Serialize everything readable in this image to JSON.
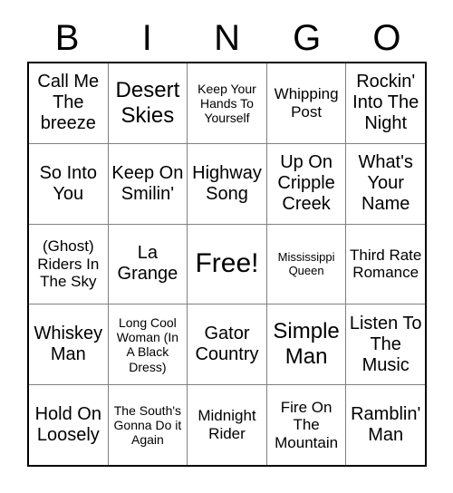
{
  "card": {
    "header_letters": [
      "B",
      "I",
      "N",
      "G",
      "O"
    ],
    "columns": 5,
    "rows": 5,
    "colors": {
      "background": "#ffffff",
      "text": "#000000",
      "outer_border": "#000000",
      "inner_border": "#808080"
    },
    "cells": [
      {
        "text": "Call Me The breeze",
        "size": "fs-md",
        "row": 1,
        "col": 1,
        "free": false
      },
      {
        "text": "Desert Skies",
        "size": "fs-lg",
        "row": 1,
        "col": 2,
        "free": false
      },
      {
        "text": "Keep Your Hands To Yourself",
        "size": "fs-xs",
        "row": 1,
        "col": 3,
        "free": false
      },
      {
        "text": "Whipping Post",
        "size": "fs-sm",
        "row": 1,
        "col": 4,
        "free": false
      },
      {
        "text": "Rockin' Into The Night",
        "size": "fs-md",
        "row": 1,
        "col": 5,
        "free": false
      },
      {
        "text": "So Into You",
        "size": "fs-md",
        "row": 2,
        "col": 1,
        "free": false
      },
      {
        "text": "Keep On Smilin'",
        "size": "fs-md",
        "row": 2,
        "col": 2,
        "free": false
      },
      {
        "text": "Highway Song",
        "size": "fs-md",
        "row": 2,
        "col": 3,
        "free": false
      },
      {
        "text": "Up On Cripple Creek",
        "size": "fs-md",
        "row": 2,
        "col": 4,
        "free": false
      },
      {
        "text": "What's Your Name",
        "size": "fs-md",
        "row": 2,
        "col": 5,
        "free": false
      },
      {
        "text": "(Ghost) Riders In The Sky",
        "size": "fs-sm",
        "row": 3,
        "col": 1,
        "free": false
      },
      {
        "text": "La Grange",
        "size": "fs-md",
        "row": 3,
        "col": 2,
        "free": false
      },
      {
        "text": "Free!",
        "size": "fs-xl",
        "row": 3,
        "col": 3,
        "free": true
      },
      {
        "text": "Mississippi Queen",
        "size": "fs-xxs",
        "row": 3,
        "col": 4,
        "free": false
      },
      {
        "text": "Third Rate Romance",
        "size": "fs-sm",
        "row": 3,
        "col": 5,
        "free": false
      },
      {
        "text": "Whiskey Man",
        "size": "fs-md",
        "row": 4,
        "col": 1,
        "free": false
      },
      {
        "text": "Long Cool Woman (In A Black Dress)",
        "size": "fs-xs",
        "row": 4,
        "col": 2,
        "free": false
      },
      {
        "text": "Gator Country",
        "size": "fs-md",
        "row": 4,
        "col": 3,
        "free": false
      },
      {
        "text": "Simple Man",
        "size": "fs-lg",
        "row": 4,
        "col": 4,
        "free": false
      },
      {
        "text": "Listen To The Music",
        "size": "fs-md",
        "row": 4,
        "col": 5,
        "free": false
      },
      {
        "text": "Hold On Loosely",
        "size": "fs-md",
        "row": 5,
        "col": 1,
        "free": false
      },
      {
        "text": "The South's Gonna Do it Again",
        "size": "fs-xs",
        "row": 5,
        "col": 2,
        "free": false
      },
      {
        "text": "Midnight Rider",
        "size": "fs-sm",
        "row": 5,
        "col": 3,
        "free": false
      },
      {
        "text": "Fire On The Mountain",
        "size": "fs-sm",
        "row": 5,
        "col": 4,
        "free": false
      },
      {
        "text": "Ramblin' Man",
        "size": "fs-md",
        "row": 5,
        "col": 5,
        "free": false
      }
    ]
  }
}
